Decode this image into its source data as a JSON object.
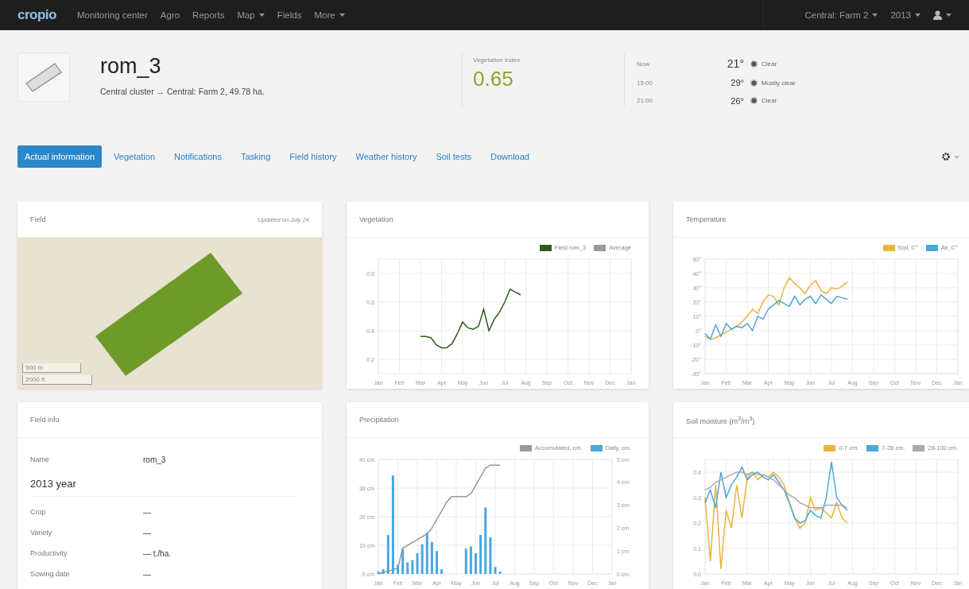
{
  "navbar": {
    "logo": "cropio",
    "items": [
      {
        "label": "Monitoring center",
        "dropdown": false
      },
      {
        "label": "Agro",
        "dropdown": false
      },
      {
        "label": "Reports",
        "dropdown": false
      },
      {
        "label": "Map",
        "dropdown": true
      },
      {
        "label": "Fields",
        "dropdown": false
      },
      {
        "label": "More",
        "dropdown": true
      }
    ],
    "right": [
      {
        "label": "Central: Farm 2",
        "dropdown": true
      },
      {
        "label": "2013",
        "dropdown": true
      }
    ]
  },
  "field": {
    "name": "rom_3",
    "path": "Central cluster → Central: Farm 2, 49.78 ha."
  },
  "vegetation_index": {
    "label": "Vegetation index",
    "value": "0.65"
  },
  "weather": [
    {
      "time": "Now",
      "temp": "21°",
      "condition": "Clear"
    },
    {
      "time": "15:00",
      "temp": "29°",
      "condition": "Mostly clear"
    },
    {
      "time": "21:00",
      "temp": "26°",
      "condition": "Clear"
    }
  ],
  "tabs": [
    {
      "label": "Actual information",
      "selected": true
    },
    {
      "label": "Vegetation",
      "selected": false
    },
    {
      "label": "Notifications",
      "selected": false
    },
    {
      "label": "Tasking",
      "selected": false
    },
    {
      "label": "Field history",
      "selected": false
    },
    {
      "label": "Weather history",
      "selected": false
    },
    {
      "label": "Soil tests",
      "selected": false
    },
    {
      "label": "Download",
      "selected": false
    }
  ],
  "cards": [
    {
      "kind": "map",
      "title": "Field",
      "updated": "Updated on July 24",
      "scale": [
        "500 m",
        "2000 ft"
      ]
    },
    {
      "kind": "chart",
      "title": "Vegetation",
      "chart_data": {
        "type": "line",
        "grid": true,
        "ylim": [
          0.1,
          0.9
        ],
        "categories": [
          "Jan",
          null,
          null,
          null,
          "Feb",
          null,
          null,
          null,
          "Mar",
          null,
          null,
          null,
          "Apr",
          null,
          null,
          null,
          "May",
          null,
          null,
          null,
          "Jun",
          null,
          null,
          null,
          "Jul",
          null,
          null,
          null,
          "Aug",
          null,
          null,
          null,
          "Sep",
          null,
          null,
          null,
          "Oct",
          null,
          null,
          null,
          "Nov",
          null,
          null,
          null,
          "Dec",
          null,
          null,
          null,
          "Jan"
        ],
        "yticks": [
          {
            "value": 0.2,
            "label": "0.2"
          },
          {
            "value": 0.4,
            "label": "0.4"
          },
          {
            "value": 0.6,
            "label": "0.6"
          },
          {
            "value": 0.8,
            "label": "0.8"
          }
        ],
        "series": [
          {
            "name": "Field rom_3",
            "color": "#2e5b1a",
            "values": [
              null,
              null,
              null,
              null,
              null,
              null,
              null,
              null,
              0.36,
              0.36,
              0.35,
              0.3,
              0.28,
              0.28,
              0.31,
              0.38,
              0.46,
              0.42,
              0.41,
              0.43,
              0.55,
              0.4,
              0.48,
              0.53,
              0.6,
              0.69,
              0.67,
              0.65,
              null,
              null,
              null,
              null,
              null,
              null,
              null,
              null,
              null,
              null,
              null,
              null,
              null,
              null,
              null,
              null,
              null,
              null,
              null,
              null,
              null
            ]
          },
          {
            "name": "Average",
            "color": "#999999",
            "values": [
              null,
              null,
              null,
              null,
              null,
              null,
              null,
              null,
              null,
              null,
              null,
              null,
              null,
              null,
              null,
              null,
              null,
              null,
              null,
              null,
              null,
              null,
              null,
              null,
              null,
              null,
              null,
              null,
              null,
              null,
              null,
              null,
              null,
              null,
              null,
              null,
              null,
              null,
              null,
              null,
              null,
              null,
              null,
              null,
              null,
              null,
              null,
              null,
              null
            ]
          }
        ]
      }
    },
    {
      "kind": "chart",
      "title": "Temperature",
      "chart_data": {
        "type": "line",
        "grid": true,
        "ylim": [
          -30,
          50
        ],
        "categories": [
          "Jan",
          null,
          null,
          null,
          "Feb",
          null,
          null,
          null,
          "Mar",
          null,
          null,
          null,
          "Apr",
          null,
          null,
          null,
          "May",
          null,
          null,
          null,
          "Jun",
          null,
          null,
          null,
          "Jul",
          null,
          null,
          null,
          "Aug",
          null,
          null,
          null,
          "Sep",
          null,
          null,
          null,
          "Oct",
          null,
          null,
          null,
          "Nov",
          null,
          null,
          null,
          "Dec",
          null,
          null,
          null,
          "Jan"
        ],
        "yticks": [
          {
            "value": -30,
            "label": "-30°"
          },
          {
            "value": -20,
            "label": "-20°"
          },
          {
            "value": -10,
            "label": "-10°"
          },
          {
            "value": 0,
            "label": "0°"
          },
          {
            "value": 10,
            "label": "10°"
          },
          {
            "value": 20,
            "label": "20°"
          },
          {
            "value": 30,
            "label": "30°"
          },
          {
            "value": 40,
            "label": "40°"
          },
          {
            "value": 50,
            "label": "50°"
          }
        ],
        "series": [
          {
            "name": "Soil, C°",
            "color": "#e8b43c",
            "values": [
              -4,
              -6,
              -5,
              -3,
              -1,
              1,
              3,
              6,
              10,
              15,
              12,
              20,
              25,
              24,
              18,
              30,
              37,
              33,
              30,
              26,
              32,
              35,
              28,
              26,
              30,
              29,
              31,
              34,
              null,
              null,
              null,
              null,
              null,
              null,
              null,
              null,
              null,
              null,
              null,
              null,
              null,
              null,
              null,
              null,
              null,
              null,
              null,
              null,
              null
            ]
          },
          {
            "name": "Air, C°",
            "color": "#4aa8dc",
            "values": [
              -2,
              -6,
              4,
              -4,
              5,
              1,
              3,
              2,
              5,
              0,
              10,
              8,
              15,
              18,
              21,
              19,
              17,
              24,
              18,
              22,
              24,
              19,
              25,
              22,
              19,
              24,
              23,
              22,
              null,
              null,
              null,
              null,
              null,
              null,
              null,
              null,
              null,
              null,
              null,
              null,
              null,
              null,
              null,
              null,
              null,
              null,
              null,
              null,
              null
            ]
          }
        ]
      }
    },
    {
      "kind": "info",
      "title": "Field info",
      "name_label": "Name",
      "name_value": "rom_3",
      "year": "2013 year",
      "rows": [
        {
          "label": "Crop",
          "value": "—"
        },
        {
          "label": "Variety",
          "value": "—"
        },
        {
          "label": "Productivity",
          "value": "— t./ha."
        },
        {
          "label": "Sowing date",
          "value": "—"
        }
      ]
    },
    {
      "kind": "chart",
      "title": "Precipitation",
      "chart_data": {
        "type": "bar",
        "grid": true,
        "ylim": [
          0,
          40
        ],
        "y2lim": [
          0,
          5
        ],
        "categories": [
          "Jan",
          null,
          null,
          null,
          "Feb",
          null,
          null,
          null,
          "Mar",
          null,
          null,
          null,
          "Apr",
          null,
          null,
          null,
          "May",
          null,
          null,
          null,
          "Jun",
          null,
          null,
          null,
          "Jul",
          null,
          null,
          null,
          "Aug",
          null,
          null,
          null,
          "Sep",
          null,
          null,
          null,
          "Oct",
          null,
          null,
          null,
          "Nov",
          null,
          null,
          null,
          "Dec",
          null,
          null,
          null,
          "Jan"
        ],
        "yticks": [
          {
            "value": 0,
            "label": "0 cm"
          },
          {
            "value": 10,
            "label": "10 cm"
          },
          {
            "value": 20,
            "label": "20 cm"
          },
          {
            "value": 30,
            "label": "30 cm"
          },
          {
            "value": 40,
            "label": "40 cm"
          }
        ],
        "y2ticks": [
          {
            "value": 0,
            "label": "0 cm"
          },
          {
            "value": 1,
            "label": "1 cm"
          },
          {
            "value": 2,
            "label": "2 cm"
          },
          {
            "value": 3,
            "label": "3 cm"
          },
          {
            "value": 4,
            "label": "4 cm"
          },
          {
            "value": 5,
            "label": "5 cm"
          }
        ],
        "series": [
          {
            "name": "Accumulated, cm.",
            "color": "#999999",
            "type": "line",
            "values": [
              0,
              0.5,
              1,
              1.5,
              2,
              9,
              10,
              11,
              12,
              13,
              14,
              16,
              19,
              22,
              25,
              27,
              27,
              27,
              27,
              28,
              31,
              34,
              37,
              38,
              38,
              38,
              null,
              null,
              null,
              null,
              null,
              null,
              null,
              null,
              null,
              null,
              null,
              null,
              null,
              null,
              null,
              null,
              null,
              null,
              null,
              null,
              null,
              null,
              null
            ]
          },
          {
            "name": "Daily, cm.",
            "color": "#4aa8dc",
            "axis": "y2",
            "values": [
              0.1,
              0.2,
              1.7,
              4.3,
              0.4,
              1.1,
              0.5,
              0.6,
              0.9,
              1.3,
              1.8,
              1.4,
              1.0,
              0.2,
              0,
              0,
              0,
              0,
              1.1,
              1.2,
              0.9,
              1.7,
              2.9,
              1.6,
              0.3,
              0.1,
              null,
              null,
              null,
              null,
              null,
              null,
              null,
              null,
              null,
              null,
              null,
              null,
              null,
              null,
              null,
              null,
              null,
              null,
              null,
              null,
              null,
              null,
              null
            ]
          }
        ]
      }
    },
    {
      "kind": "chart",
      "title": "Soil moisture (m$^{3}$/m$^{3}$)",
      "chart_data": {
        "type": "line",
        "grid": true,
        "ylim": [
          0,
          0.45
        ],
        "categories": [
          "Jan",
          null,
          null,
          null,
          "Feb",
          null,
          null,
          null,
          "Mar",
          null,
          null,
          null,
          "Apr",
          null,
          null,
          null,
          "May",
          null,
          null,
          null,
          "Jun",
          null,
          null,
          null,
          "Jul",
          null,
          null,
          null,
          "Aug",
          null,
          null,
          null,
          "Sep",
          null,
          null,
          null,
          "Oct",
          null,
          null,
          null,
          "Nov",
          null,
          null,
          null,
          "Dec",
          null,
          null,
          null,
          "Jan"
        ],
        "yticks": [
          {
            "value": 0,
            "label": "0.0"
          },
          {
            "value": 0.1,
            "label": "0.1"
          },
          {
            "value": 0.2,
            "label": "0.2"
          },
          {
            "value": 0.3,
            "label": "0.3"
          },
          {
            "value": 0.4,
            "label": "0.4"
          }
        ],
        "series": [
          {
            "name": "0-7 cm.",
            "color": "#e8b43c",
            "values": [
              0.3,
              0.05,
              0.35,
              0.02,
              0.25,
              0.18,
              0.35,
              0.22,
              0.38,
              0.4,
              0.37,
              0.39,
              0.38,
              0.4,
              0.38,
              0.35,
              0.28,
              0.22,
              0.18,
              0.2,
              0.3,
              0.25,
              0.26,
              0.24,
              0.22,
              0.28,
              0.22,
              0.2,
              null,
              null,
              null,
              null,
              null,
              null,
              null,
              null,
              null,
              null,
              null,
              null,
              null,
              null,
              null,
              null,
              null,
              null,
              null,
              null,
              null
            ]
          },
          {
            "name": "7-28 cm.",
            "color": "#4aa8dc",
            "values": [
              0.28,
              0.33,
              0.26,
              0.4,
              0.3,
              0.35,
              0.38,
              0.42,
              0.37,
              0.39,
              0.4,
              0.38,
              0.37,
              0.39,
              0.36,
              0.33,
              0.28,
              0.22,
              0.2,
              0.21,
              0.25,
              0.23,
              0.22,
              0.3,
              0.44,
              0.3,
              0.27,
              0.25,
              null,
              null,
              null,
              null,
              null,
              null,
              null,
              null,
              null,
              null,
              null,
              null,
              null,
              null,
              null,
              null,
              null,
              null,
              null,
              null,
              null
            ]
          },
          {
            "name": "28-100 cm.",
            "color": "#aaaaaa",
            "values": [
              0.33,
              0.34,
              0.36,
              0.37,
              0.38,
              0.39,
              0.4,
              0.4,
              0.39,
              0.4,
              0.39,
              0.39,
              0.38,
              0.37,
              0.35,
              0.33,
              0.31,
              0.3,
              0.28,
              0.27,
              0.26,
              0.26,
              0.26,
              0.27,
              0.27,
              0.27,
              0.27,
              0.26,
              null,
              null,
              null,
              null,
              null,
              null,
              null,
              null,
              null,
              null,
              null,
              null,
              null,
              null,
              null,
              null,
              null,
              null,
              null,
              null,
              null
            ]
          }
        ]
      }
    }
  ]
}
